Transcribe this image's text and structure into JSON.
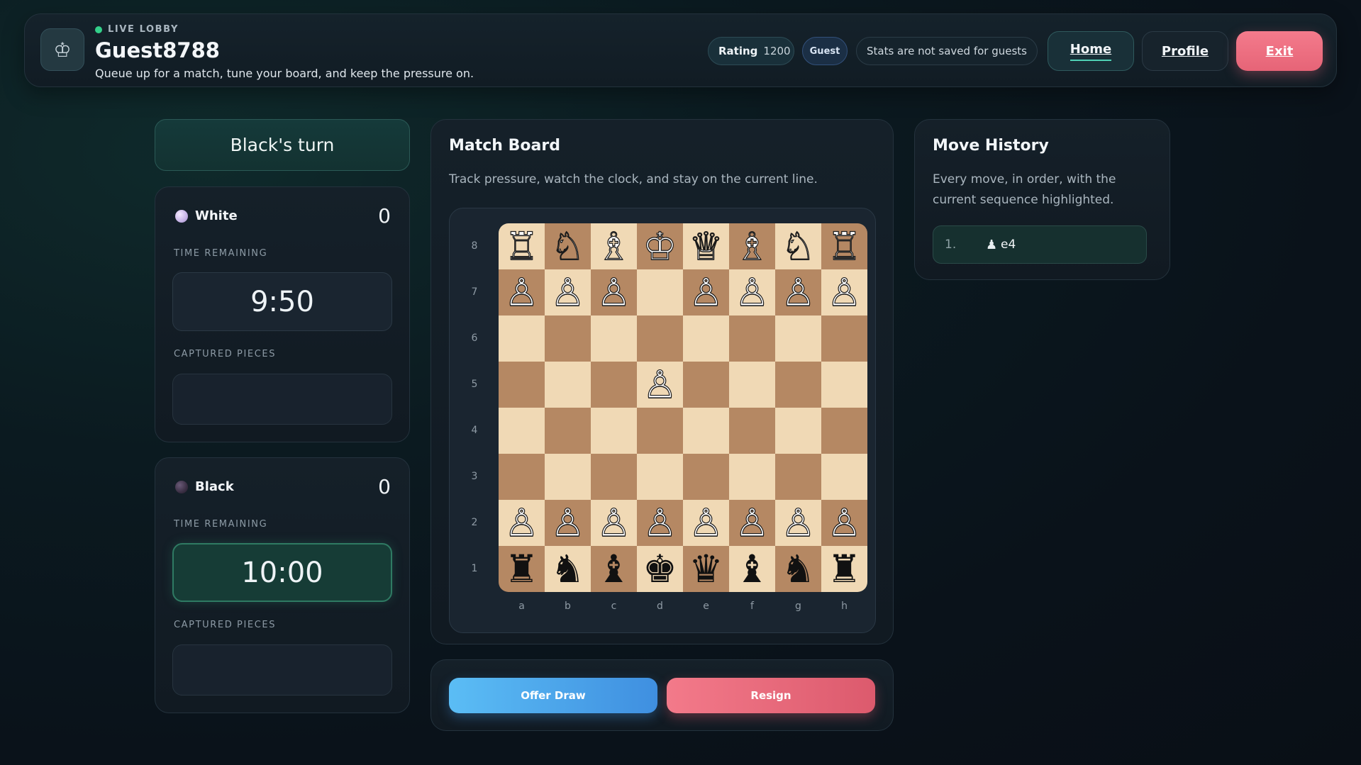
{
  "header": {
    "live_label": "LIVE LOBBY",
    "username": "Guest8788",
    "tagline": "Queue up for a match, tune your board, and keep the pressure on.",
    "rating_label": "Rating",
    "rating_value": "1200",
    "role_badge": "Guest",
    "stats_note": "Stats are not saved for guests",
    "nav": {
      "home": "Home",
      "profile": "Profile",
      "exit": "Exit"
    },
    "brand_icon": "crown-icon"
  },
  "turn": {
    "text": "Black's turn"
  },
  "players": {
    "white": {
      "name": "White",
      "score": "0",
      "time_label": "TIME REMAINING",
      "clock": "9:50",
      "captured_label": "CAPTURED PIECES"
    },
    "black": {
      "name": "Black",
      "score": "0",
      "time_label": "TIME REMAINING",
      "clock": "10:00",
      "captured_label": "CAPTURED PIECES"
    }
  },
  "board_panel": {
    "title": "Match Board",
    "subtitle": "Track pressure, watch the clock, and stay on the current line.",
    "ranks": [
      "8",
      "7",
      "6",
      "5",
      "4",
      "3",
      "2",
      "1"
    ],
    "files": [
      "a",
      "b",
      "c",
      "d",
      "e",
      "f",
      "g",
      "h"
    ],
    "squares": [
      [
        "♖w",
        "♘w",
        "♗w",
        "♔w",
        "♕w",
        "♗w",
        "♘w",
        "♖w"
      ],
      [
        "♙w",
        "♙w",
        "♙w",
        "",
        "♙w",
        "♙w",
        "♙w",
        "♙w"
      ],
      [
        "",
        "",
        "",
        "",
        "",
        "",
        "",
        ""
      ],
      [
        "",
        "",
        "",
        "♙w",
        "",
        "",
        "",
        ""
      ],
      [
        "",
        "",
        "",
        "",
        "",
        "",
        "",
        ""
      ],
      [
        "",
        "",
        "",
        "",
        "",
        "",
        "",
        ""
      ],
      [
        "♙w",
        "♙w",
        "♙w",
        "♙w",
        "♙w",
        "♙w",
        "♙w",
        "♙w"
      ],
      [
        "♜b",
        "♞b",
        "♝b",
        "♚b",
        "♛b",
        "♝b",
        "♞b",
        "♜b"
      ]
    ]
  },
  "actions": {
    "draw": "Offer Draw",
    "resign": "Resign"
  },
  "history": {
    "title": "Move History",
    "subtitle": "Every move, in order, with the current sequence highlighted.",
    "moves": [
      {
        "number": "1.",
        "piece_icon": "♟",
        "san": "e4"
      }
    ]
  },
  "colors": {
    "accent_teal": "#2f7a63",
    "board_light": "#f0d9b5",
    "board_dark": "#b58863",
    "draw_button": "#3f8fe0",
    "resign_button": "#dc5a6d",
    "live_dot": "#33d08a"
  }
}
